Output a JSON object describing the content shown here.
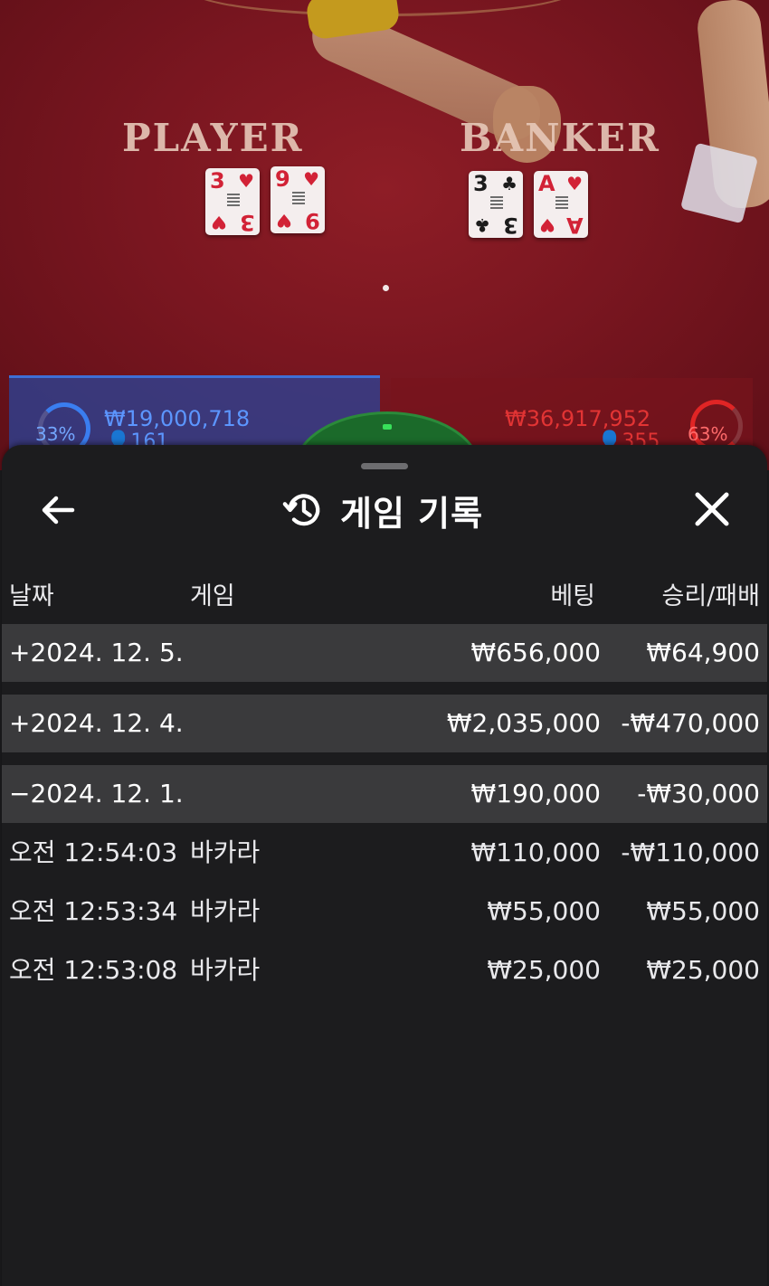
{
  "video": {
    "player_label": "PLAYER",
    "banker_label": "BANKER",
    "player_cards": [
      {
        "rank": "3",
        "suit": "♥",
        "color": "#d22236"
      },
      {
        "rank": "9",
        "suit": "♥",
        "color": "#d22236"
      }
    ],
    "banker_cards": [
      {
        "rank": "3",
        "suit": "♣",
        "color": "#1c1c1c"
      },
      {
        "rank": "A",
        "suit": "♥",
        "color": "#d22236"
      }
    ],
    "player_bar": {
      "percent": "33%",
      "amount": "₩19,000,718",
      "count": "161"
    },
    "banker_bar": {
      "percent": "63%",
      "amount": "₩36,917,952",
      "count": "355"
    }
  },
  "history": {
    "title": "게임 기록",
    "back_icon": "arrow-left-icon",
    "history_icon": "history-clock-icon",
    "close_icon": "close-icon",
    "columns": {
      "date": "날짜",
      "game": "게임",
      "bet": "베팅",
      "result": "승리/패배"
    },
    "groups": [
      {
        "date": "+2024. 12. 5.",
        "bet": "₩656,000",
        "result": "₩64,900",
        "expanded": false,
        "items": []
      },
      {
        "date": "+2024. 12. 4.",
        "bet": "₩2,035,000",
        "result": "-₩470,000",
        "expanded": false,
        "items": []
      },
      {
        "date": "−2024. 12. 1.",
        "bet": "₩190,000",
        "result": "-₩30,000",
        "expanded": true,
        "items": [
          {
            "time": "오전 12:54:03",
            "game": "바카라",
            "bet": "₩110,000",
            "result": "-₩110,000"
          },
          {
            "time": "오전 12:53:34",
            "game": "바카라",
            "bet": "₩55,000",
            "result": "₩55,000"
          },
          {
            "time": "오전 12:53:08",
            "game": "바카라",
            "bet": "₩25,000",
            "result": "₩25,000"
          }
        ]
      }
    ]
  },
  "colors": {
    "sheet_bg": "#1c1c1e",
    "row_bg": "#3a3a3c",
    "table_felt": "#7a1620",
    "player_blue": "#3a7ef0",
    "banker_red": "#e02525"
  }
}
